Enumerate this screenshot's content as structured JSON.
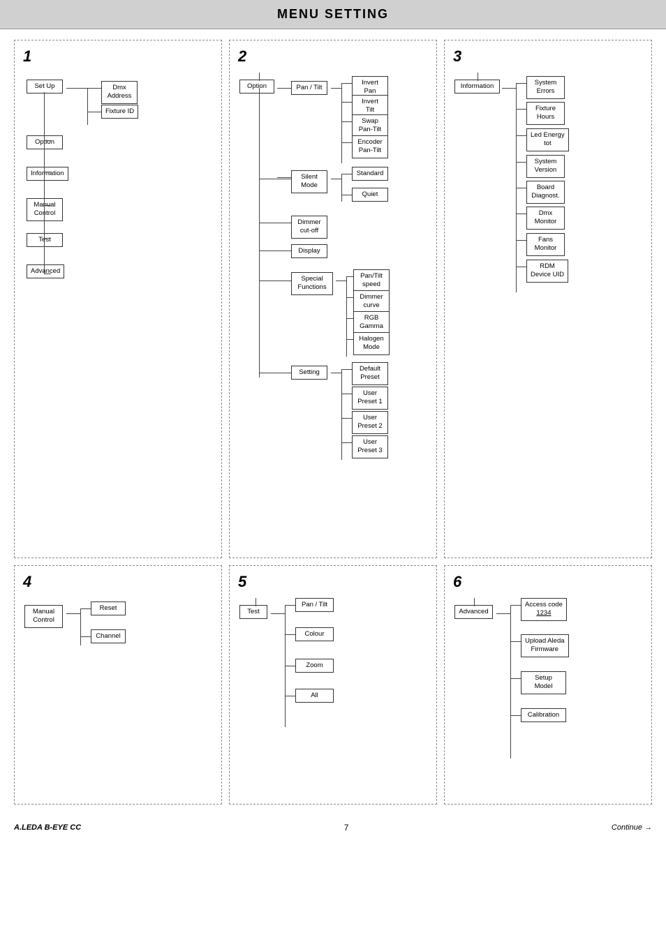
{
  "header": {
    "title": "MENU SETTING"
  },
  "footer": {
    "brand": "A.LEDA B-EYE CC",
    "page": "7",
    "continue": "Continue →"
  },
  "panels": {
    "p1": {
      "number": "1",
      "nodes": [
        {
          "id": "setup",
          "label": "Set Up"
        },
        {
          "id": "dmx_address",
          "label": "Dmx\nAddress"
        },
        {
          "id": "fixture_id",
          "label": "Fixture ID"
        },
        {
          "id": "option",
          "label": "Option"
        },
        {
          "id": "information",
          "label": "Information"
        },
        {
          "id": "manual_control",
          "label": "Manual\nControl"
        },
        {
          "id": "test",
          "label": "Test"
        },
        {
          "id": "advanced",
          "label": "Advanced"
        }
      ]
    },
    "p2": {
      "number": "2",
      "nodes": [
        {
          "id": "option",
          "label": "Option"
        },
        {
          "id": "pan_tilt",
          "label": "Pan / Tilt"
        },
        {
          "id": "invert_pan",
          "label": "Invert\nPan"
        },
        {
          "id": "invert_tilt",
          "label": "Invert\nTilt"
        },
        {
          "id": "swap_pan_tilt",
          "label": "Swap\nPan-Tilt"
        },
        {
          "id": "encoder_pan_tilt",
          "label": "Encoder\nPan-Tilt"
        },
        {
          "id": "silent_mode",
          "label": "Silent\nMode"
        },
        {
          "id": "standard",
          "label": "Standard"
        },
        {
          "id": "quiet",
          "label": "Quiet"
        },
        {
          "id": "dimmer_cutoff",
          "label": "Dimmer\ncut-off"
        },
        {
          "id": "display",
          "label": "Display"
        },
        {
          "id": "special_functions",
          "label": "Special\nFunctions"
        },
        {
          "id": "pan_tilt_speed",
          "label": "Pan/Tilt\nspeed"
        },
        {
          "id": "dimmer_curve",
          "label": "Dimmer\ncurve"
        },
        {
          "id": "rgb_gamma",
          "label": "RGB\nGamma"
        },
        {
          "id": "halogen_mode",
          "label": "Halogen\nMode"
        },
        {
          "id": "setting",
          "label": "Setting"
        },
        {
          "id": "default_preset",
          "label": "Default\nPreset"
        },
        {
          "id": "user_preset_1",
          "label": "User\nPreset 1"
        },
        {
          "id": "user_preset_2",
          "label": "User\nPreset 2"
        },
        {
          "id": "user_preset_3",
          "label": "User\nPreset 3"
        }
      ]
    },
    "p3": {
      "number": "3",
      "nodes": [
        {
          "id": "information",
          "label": "Information"
        },
        {
          "id": "system_errors",
          "label": "System\nErrors"
        },
        {
          "id": "fixture_hours",
          "label": "Fixture\nHours"
        },
        {
          "id": "led_energy_tot",
          "label": "Led Energy\ntot"
        },
        {
          "id": "system_version",
          "label": "System\nVersion"
        },
        {
          "id": "board_diagnost",
          "label": "Board\nDiagnost."
        },
        {
          "id": "dmx_monitor",
          "label": "Dmx\nMonitor"
        },
        {
          "id": "fans_monitor",
          "label": "Fans\nMonitor"
        },
        {
          "id": "rdm_device_uid",
          "label": "RDM\nDevice UID"
        }
      ]
    },
    "p4": {
      "number": "4",
      "nodes": [
        {
          "id": "manual_control",
          "label": "Manual\nControl"
        },
        {
          "id": "reset",
          "label": "Reset"
        },
        {
          "id": "channel",
          "label": "Channel"
        }
      ]
    },
    "p5": {
      "number": "5",
      "nodes": [
        {
          "id": "test",
          "label": "Test"
        },
        {
          "id": "pan_tilt",
          "label": "Pan / Tilt"
        },
        {
          "id": "colour",
          "label": "Colour"
        },
        {
          "id": "zoom",
          "label": "Zoom"
        },
        {
          "id": "all",
          "label": "All"
        }
      ]
    },
    "p6": {
      "number": "6",
      "nodes": [
        {
          "id": "advanced",
          "label": "Advanced"
        },
        {
          "id": "access_code",
          "label": "Access code\n1234"
        },
        {
          "id": "upload_aleda",
          "label": "Upload Aleda\nFirmware"
        },
        {
          "id": "setup_model",
          "label": "Setup\nModel"
        },
        {
          "id": "calibration",
          "label": "Calibration"
        }
      ]
    }
  }
}
